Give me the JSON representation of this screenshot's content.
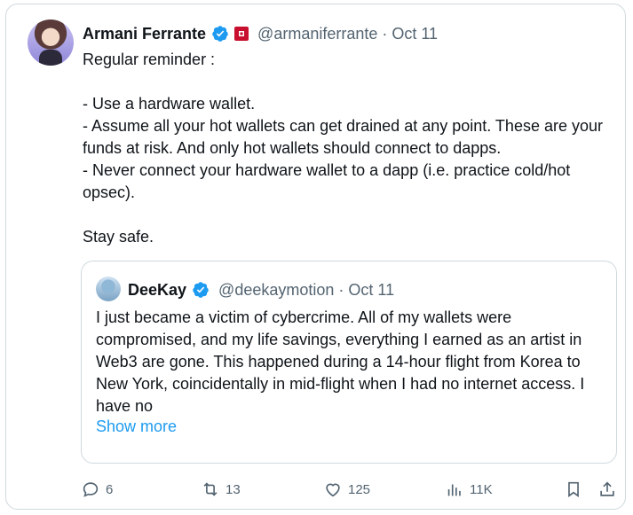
{
  "tweet": {
    "author_name": "Armani Ferrante",
    "handle": "@armaniferrante",
    "separator": "·",
    "date": "Oct 11",
    "text": "Regular reminder :\n\n- Use a hardware wallet.\n- Assume all your hot wallets can get drained at any point. These are your funds at risk. And only hot wallets should connect to dapps.\n- Never connect your hardware wallet to a dapp (i.e. practice cold/hot opsec).\n\nStay safe.",
    "verified": true,
    "badge_icon": "red-square-badge-icon"
  },
  "quoted_tweet": {
    "author_name": "DeeKay",
    "handle": "@deekaymotion",
    "separator": "·",
    "date": "Oct 11",
    "text": "I just became a victim of cybercrime. All of my wallets were compromised, and my life savings, everything I earned as an artist in Web3 are gone. This happened during a 14-hour flight from Korea to New York, coincidentally in mid-flight when I had no internet access. I have no",
    "show_more_label": "Show more",
    "verified": true
  },
  "actions": {
    "replies": "6",
    "reposts": "13",
    "likes": "125",
    "views": "11K"
  },
  "colors": {
    "accent": "#1d9bf0",
    "secondary_text": "#536471",
    "border": "#cfd9de",
    "badge": "#c8102e"
  }
}
